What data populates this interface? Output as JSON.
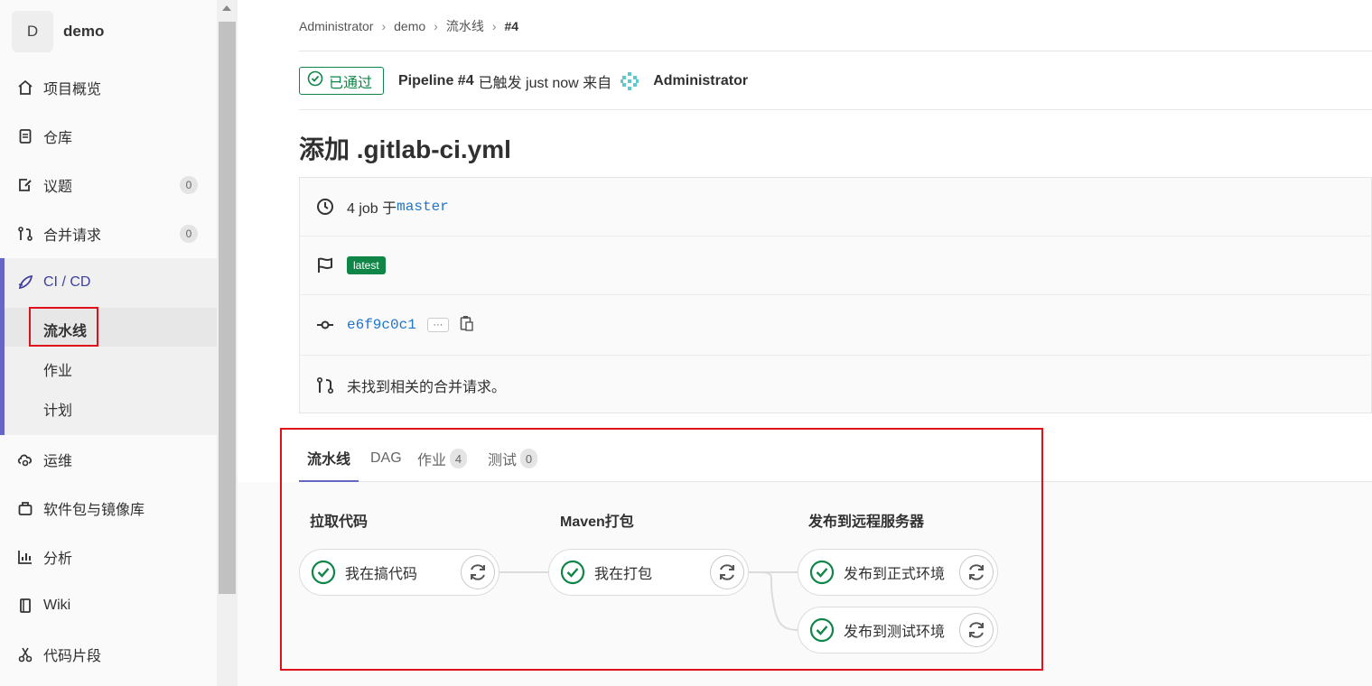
{
  "sidebar": {
    "project_initial": "D",
    "project_name": "demo",
    "items": [
      {
        "label": "项目概览",
        "icon": "home-icon"
      },
      {
        "label": "仓库",
        "icon": "document-icon"
      },
      {
        "label": "议题",
        "icon": "issues-icon",
        "badge": "0"
      },
      {
        "label": "合并请求",
        "icon": "merge-request-icon",
        "badge": "0"
      },
      {
        "label": "CI / CD",
        "icon": "rocket-icon"
      },
      {
        "label": "运维",
        "icon": "cloud-gear-icon"
      },
      {
        "label": "软件包与镜像库",
        "icon": "package-icon"
      },
      {
        "label": "分析",
        "icon": "chart-icon"
      },
      {
        "label": "Wiki",
        "icon": "book-icon"
      },
      {
        "label": "代码片段",
        "icon": "scissors-icon"
      }
    ],
    "cicd_sub": [
      "流水线",
      "作业",
      "计划"
    ]
  },
  "breadcrumb": [
    "Administrator",
    "demo",
    "流水线",
    "#4"
  ],
  "header": {
    "status": "已通过",
    "pipeline_label": "Pipeline #4",
    "triggered_text": "已触发 just now 来自",
    "user": "Administrator"
  },
  "title": "添加 .gitlab-ci.yml",
  "info": {
    "jobs_text": "4 job 于",
    "branch": "master",
    "tag": "latest",
    "commit": "e6f9c0c1",
    "more": "···",
    "mr_text": "未找到相关的合并请求。"
  },
  "tabs": [
    {
      "label": "流水线"
    },
    {
      "label": "DAG"
    },
    {
      "label": "作业",
      "count": "4"
    },
    {
      "label": "测试",
      "count": "0"
    }
  ],
  "stages": [
    {
      "title": "拉取代码",
      "jobs": [
        "我在搞代码"
      ]
    },
    {
      "title": "Maven打包",
      "jobs": [
        "我在打包"
      ]
    },
    {
      "title": "发布到远程服务器",
      "jobs": [
        "发布到正式环境",
        "发布到测试环境"
      ]
    }
  ],
  "colors": {
    "success": "#108548",
    "accent": "#6666c4",
    "highlight": "#e0101a"
  }
}
